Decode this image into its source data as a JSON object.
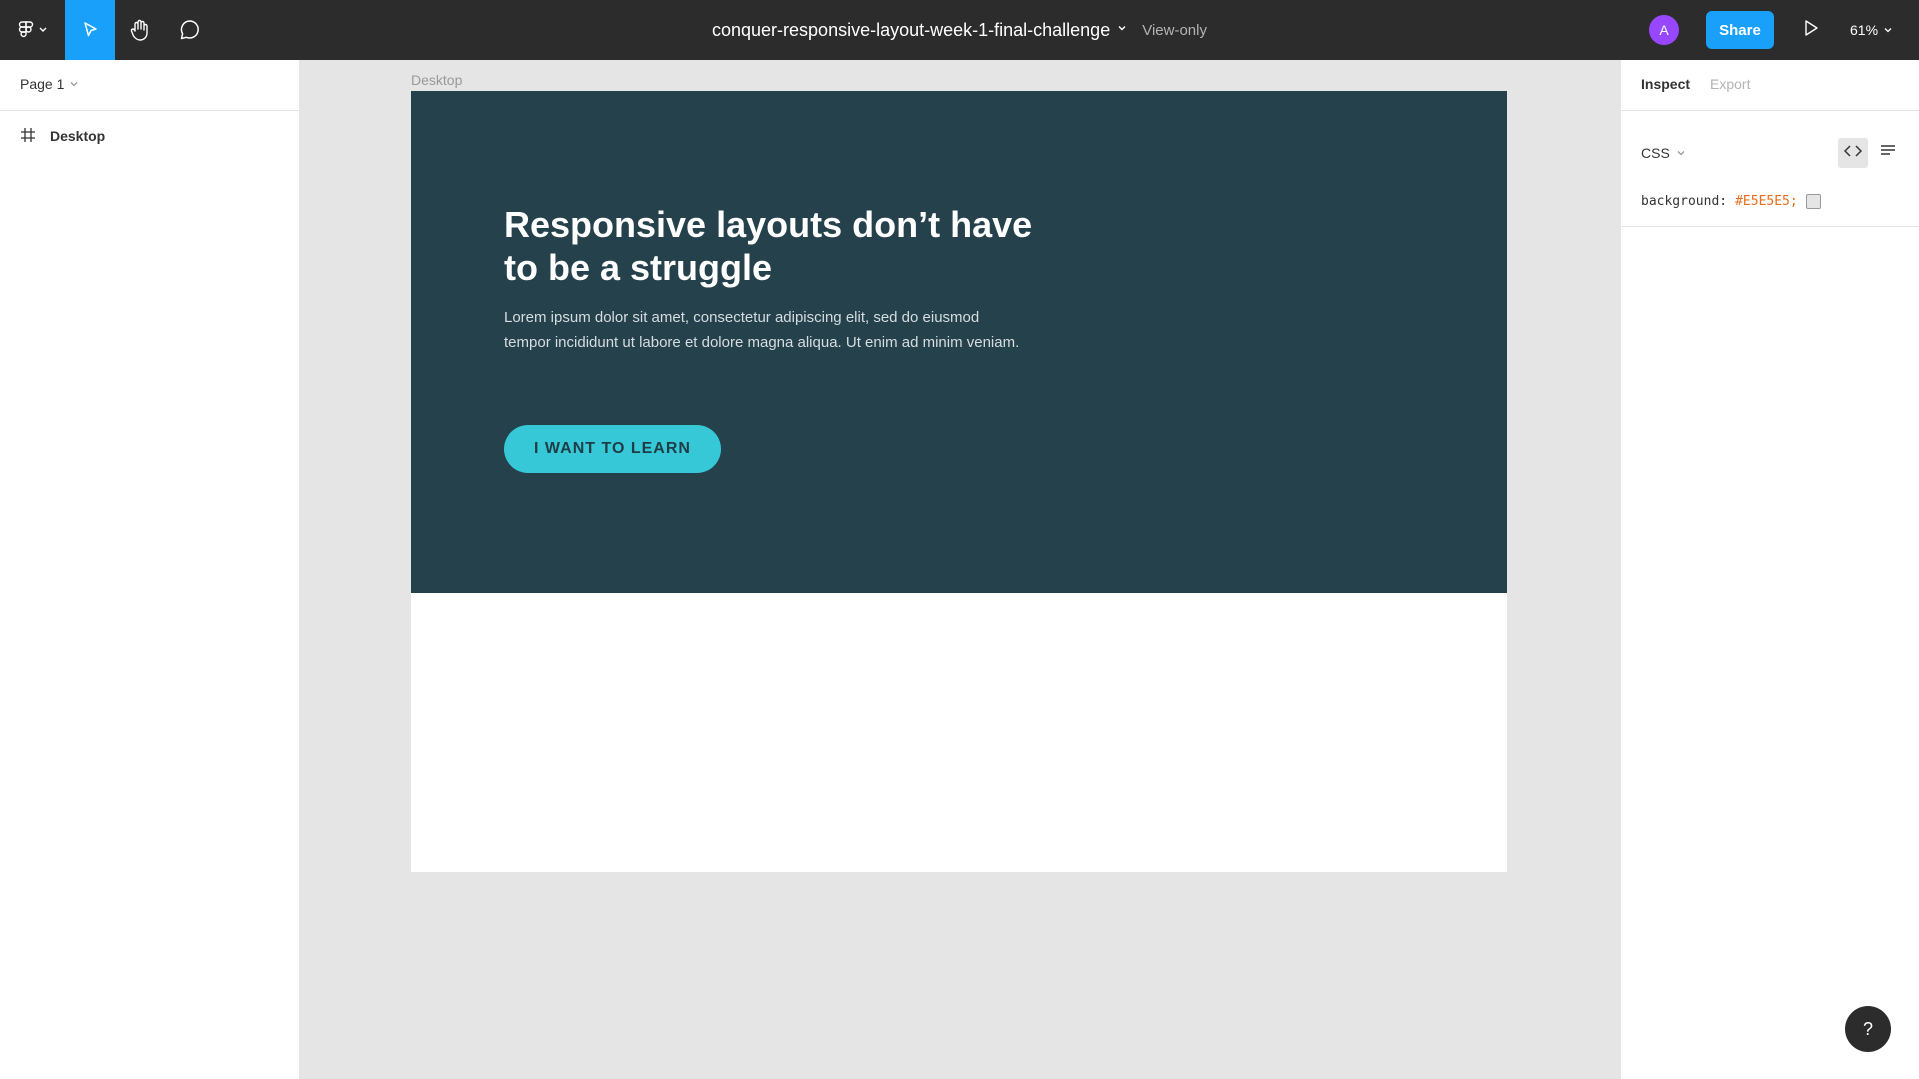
{
  "toolbar": {
    "file_name": "conquer-responsive-layout-week-1-final-challenge",
    "view_mode": "View-only",
    "avatar_initial": "A",
    "share_label": "Share",
    "zoom": "61%",
    "icons": [
      "figma-menu-icon",
      "move-tool-icon",
      "hand-tool-icon",
      "comment-tool-icon",
      "chevron-down-icon",
      "play-icon"
    ]
  },
  "left_panel": {
    "page": "Page 1",
    "layers": [
      {
        "icon": "frame-icon",
        "label": "Desktop"
      }
    ]
  },
  "canvas": {
    "frame_label": "Desktop",
    "hero": {
      "title": "Responsive layouts don’t have to be a struggle",
      "body": "Lorem ipsum dolor sit amet, consectetur adipiscing elit, sed do eiusmod tempor incididunt ut labore et dolore magna aliqua. Ut enim ad minim veniam.",
      "button_label": "I WANT TO LEARN"
    }
  },
  "right_panel": {
    "tabs": [
      "Inspect",
      "Export"
    ],
    "active_tab": "Inspect",
    "code_language": "CSS",
    "css": {
      "property": "background:",
      "value": "#E5E5E5;"
    }
  },
  "help_label": "?",
  "colors": {
    "toolbar_bg": "#2c2c2c",
    "accent_blue": "#18a0fb",
    "hero_bg": "#25414b",
    "button_cyan": "#36c8d6",
    "canvas_bg": "#e5e5e5",
    "avatar_purple": "#9747ff"
  }
}
